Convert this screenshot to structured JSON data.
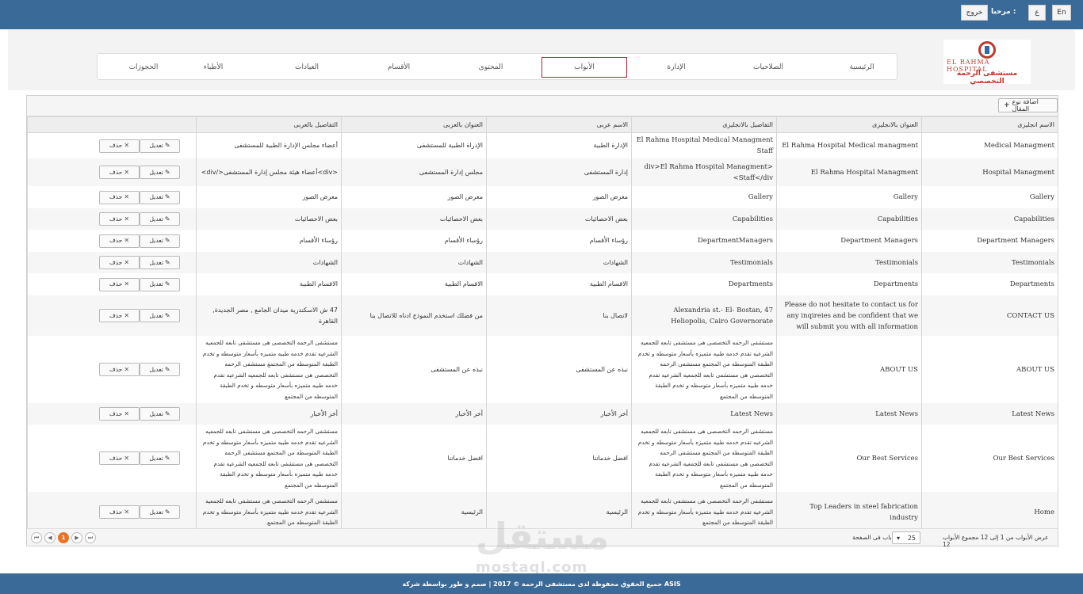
{
  "topbar": {
    "lang_en": "En",
    "lang_ar": "ع",
    "logout": "خروج",
    "welcome": "مرحبا :"
  },
  "logo": {
    "line1": "EL RAHMA HOSPITAL",
    "line2": "مستشفى الرحمة التخصصي"
  },
  "nav": {
    "items": [
      "الرئيسية",
      "الصلاحيات",
      "الإدارة",
      "الأبواب",
      "المحتوى",
      "الأقسام",
      "العيادات",
      "الأطباء",
      "الحجوزات"
    ],
    "active_index": 3
  },
  "toolbar": {
    "add_label": "اضافة نوع المقال"
  },
  "table": {
    "headers": [
      "الاسم انجليزى",
      "العنوان بالانجليزى",
      "التفاصيل بالانجليزى",
      "الاسم عربى",
      "العنوان بالعربى",
      "التفاصيل بالعربى"
    ],
    "edit_label": "تعديل",
    "delete_label": "حذف",
    "rows": [
      [
        "Medical Managment",
        "El Rahma Hospital Medical managment",
        "El Rahma Hospital Medical Managment Staff",
        "الإدارة الطبية",
        "الإدراة الطبية للمستشفى",
        "أعضاء مجلس الإدارة الطبية للمستشفى"
      ],
      [
        "Hospital Managment",
        "El Rahma Hospital Managment",
        "<div>El Rahma Hospital Managment Staff</div>",
        "إدارة المستشفى",
        "مجلس إدارة المستشفى",
        "<div>أعضاء هيئة مجلس إدارة المستشفى</div>"
      ],
      [
        "Gallery",
        "Gallery",
        "Gallery",
        "معرض الصور",
        "معرض الصور",
        "معرض الصور"
      ],
      [
        "Capabilities",
        "Capabilities",
        "Capabilities",
        "بعض الاحصائيات",
        "بعض الاحصائيات",
        "بعض الاحصائيات"
      ],
      [
        "Department Managers",
        "Department Managers",
        "DepartmentManagers",
        "رؤساء الأقسام",
        "رؤساء الأقسام",
        "رؤساء الأقسام"
      ],
      [
        "Testimonials",
        "Testimonials",
        "Testimonials",
        "الشهادات",
        "الشهادات",
        "الشهادات"
      ],
      [
        "Departments",
        "Departments",
        "Departments",
        "الاقسام الطبية",
        "الاقسام الطبية",
        "الاقسام الطبية"
      ],
      [
        "CONTACT US",
        "Please do not hesitate to contact us for any inqireies and be confident that we will submit you with all information",
        "47 Alexandria st.- El- Bostan, Heliopolis, Cairo Governorate",
        "لاتصال بنا",
        "من فضلك استخدم النموذج ادناه للاتصال بنا",
        "47 ش الاسكندرية ميدان الجامع , مصر الجديدة, القاهرة"
      ],
      [
        "ABOUT US",
        "ABOUT US",
        "مستشفى الرحمه التخصصى هى مستشفى تابعه للجمعيه الشرعيه تقدم خدمه طبيه متميزه بأسعار متوسطه و تخدم الطبقة المتوسطه من المجتمع مستشفى الرحمه التخصصى هى مستشفى تابعه للجمعيه الشرعيه تقدم خدمه طبيه متميزه بأسعار متوسطه و تخدم الطبقة المتوسطه من المجتمع",
        "نبذه عن المستشفى",
        "نبذه عن المستشفى",
        "مستشفى الرحمه التخصصى هى مستشفى تابعه للجمعيه الشرعيه تقدم خدمه طبيه متميزه بأسعار متوسطه و تخدم الطبقة المتوسطه من المجتمع مستشفى الرحمه التخصصى هى مستشفى تابعه للجمعيه الشرعيه تقدم خدمه طبيه متميزه بأسعار متوسطه و تخدم الطبقة المتوسطه من المجتمع"
      ],
      [
        "Latest News",
        "Latest News",
        "Latest News",
        "أخر الأخبار",
        "أخر الأخبار",
        "أخر الأخبار"
      ],
      [
        "Our Best Services",
        "Our Best Services",
        "مستشفى الرحمه التخصصى هى مستشفى تابعه للجمعيه الشرعيه تقدم خدمه طبيه متميزه بأسعار متوسطه و تخدم الطبقة المتوسطه من المجتمع مستشفى الرحمه التخصصى هى مستشفى تابعه للجمعيه الشرعيه تقدم خدمه طبيه متميزه بأسعار متوسطه و تخدم الطبقة المتوسطه من المجتمع",
        "افضل خدماتنا",
        "افضل خدماتنا",
        "مستشفى الرحمه التخصصى هى مستشفى تابعه للجمعيه الشرعيه تقدم خدمه طبيه متميزه بأسعار متوسطه و تخدم الطبقة المتوسطه من المجتمع مستشفى الرحمه التخصصى هى مستشفى تابعه للجمعيه الشرعيه تقدم خدمه طبيه متميزه بأسعار متوسطه و تخدم الطبقة المتوسطه من المجتمع"
      ],
      [
        "Home",
        "Top Leaders in steel fabrication industry",
        "مستشفى الرحمه التخصصى هى مستشفى تابعه للجمعيه الشرعيه تقدم خدمه طبيه متميزه بأسعار متوسطه و تخدم الطبقة المتوسطه من المجتمع",
        "الرئيسية",
        "الرئيسية",
        "مستشفى الرحمه التخصصى هى مستشفى تابعه للجمعيه الشرعيه تقدم خدمه طبيه متميزه بأسعار متوسطه و تخدم الطبقة المتوسطه من المجتمع"
      ]
    ]
  },
  "pager": {
    "current_page": "1",
    "page_size": "25",
    "page_size_label": "باب فى الصفحة",
    "info": "عرض الأبواب من 1 إلى 12 مجموع الأبواب 12"
  },
  "footer": {
    "text": "جميع الحقوق محفوظة لدى مستشفى الرحمة © 2017 | صمم و طور بواسطة شركة ASIS"
  },
  "watermark": {
    "main": "مستقل",
    "sub": "mostaql.com"
  },
  "colors": {
    "topbar": "#3a6a98",
    "active_nav_border": "#b42335",
    "current_page": "#e8742a"
  }
}
